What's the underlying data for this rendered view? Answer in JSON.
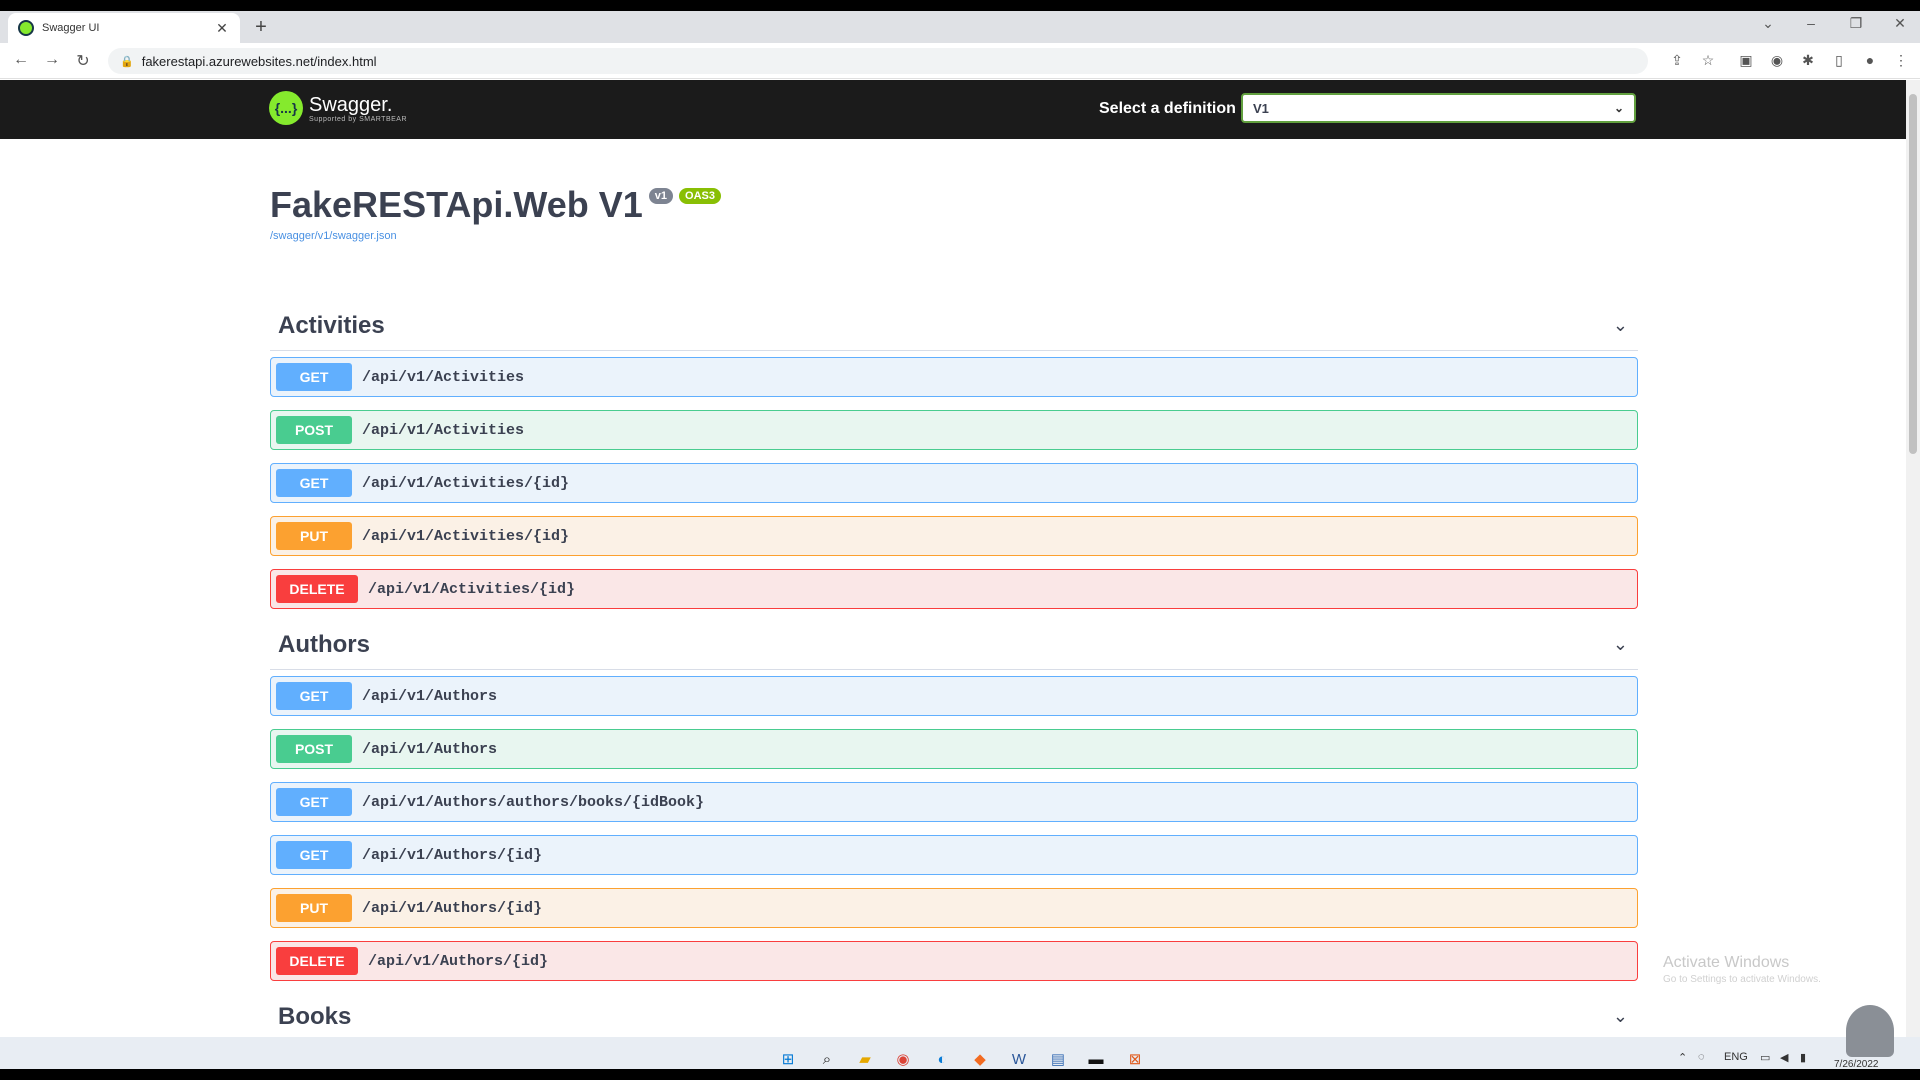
{
  "browser": {
    "tab_title": "Swagger UI",
    "tab_close": "✕",
    "new_tab": "+",
    "url": "fakerestapi.azurewebsites.net/index.html",
    "icons": [
      "back-icon",
      "forward-icon",
      "reload-icon",
      "lock-icon",
      "share-icon",
      "star-icon",
      "extension-icon",
      "profile-icon",
      "menu-icon"
    ]
  },
  "swagger": {
    "logo_mark": "{...}",
    "logo_name": "Swagger.",
    "logo_sub": "Supported by SMARTBEAR",
    "definition_label": "Select a definition",
    "definition_value": "V1"
  },
  "info": {
    "title": "FakeRESTApi.Web V1",
    "version_badge": "v1",
    "oas_badge": "OAS3",
    "spec_link": "/swagger/v1/swagger.json"
  },
  "sections": [
    {
      "name": "Activities",
      "operations": [
        {
          "method": "GET",
          "path": "/api/v1/Activities"
        },
        {
          "method": "POST",
          "path": "/api/v1/Activities"
        },
        {
          "method": "GET",
          "path": "/api/v1/Activities/{id}"
        },
        {
          "method": "PUT",
          "path": "/api/v1/Activities/{id}"
        },
        {
          "method": "DELETE",
          "path": "/api/v1/Activities/{id}"
        }
      ]
    },
    {
      "name": "Authors",
      "operations": [
        {
          "method": "GET",
          "path": "/api/v1/Authors"
        },
        {
          "method": "POST",
          "path": "/api/v1/Authors"
        },
        {
          "method": "GET",
          "path": "/api/v1/Authors/authors/books/{idBook}"
        },
        {
          "method": "GET",
          "path": "/api/v1/Authors/{id}"
        },
        {
          "method": "PUT",
          "path": "/api/v1/Authors/{id}"
        },
        {
          "method": "DELETE",
          "path": "/api/v1/Authors/{id}"
        }
      ]
    },
    {
      "name": "Books",
      "operations": []
    }
  ],
  "watermark": {
    "title": "Activate Windows",
    "subtitle": "Go to Settings to activate Windows."
  },
  "taskbar": {
    "lang": "ENG",
    "date": "7/26/2022"
  }
}
